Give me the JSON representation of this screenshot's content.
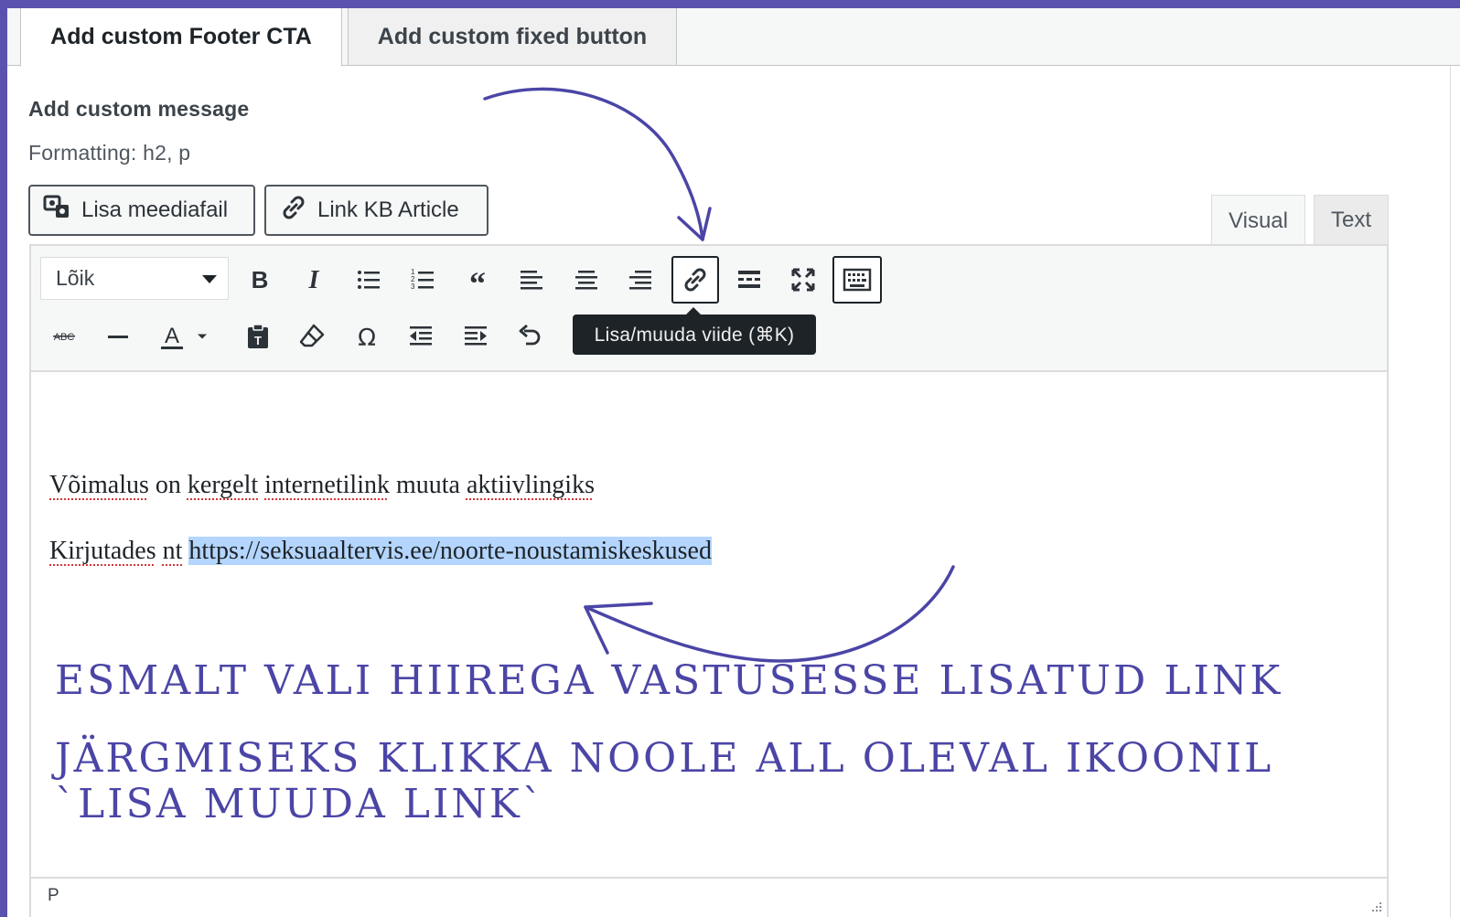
{
  "tabs": [
    {
      "label": "Add custom Footer CTA",
      "active": true
    },
    {
      "label": "Add custom fixed button",
      "active": false
    }
  ],
  "field": {
    "label": "Add custom message",
    "formatting": "Formatting: h2, p"
  },
  "buttons": {
    "media": "Lisa meediafail",
    "kb": "Link KB Article"
  },
  "modes": {
    "visual": "Visual",
    "text": "Text",
    "active": "visual"
  },
  "toolbar": {
    "format_select": "Lõik",
    "row1": [
      "bold-icon",
      "italic-icon",
      "bullet-list-icon",
      "numbered-list-icon",
      "blockquote-icon",
      "align-left-icon",
      "align-center-icon",
      "align-right-icon",
      "link-icon",
      "read-more-icon",
      "fullscreen-icon",
      "toolbar-toggle-icon"
    ],
    "row2": [
      "strikethrough-icon",
      "horizontal-line-icon",
      "text-color-icon",
      "paste-text-icon",
      "clear-formatting-icon",
      "special-character-icon",
      "outdent-icon",
      "indent-icon",
      "undo-icon"
    ],
    "tooltip": "Lisa/muuda viide (⌘K)"
  },
  "content": {
    "line1": {
      "w1": "Võimalus",
      "w2": "on",
      "w3": "kergelt",
      "w4": "internetilink",
      "w5": "muuta",
      "w6": "aktiivlingiks"
    },
    "line2": {
      "w1": "Kirjutades",
      "w2": "nt",
      "url": "https://seksuaaltervis.ee/noorte-noustamiskeskused"
    }
  },
  "status": {
    "path": "P"
  },
  "annotations": {
    "step1": "Esmalt vali hiirega vastusesse lisatud link",
    "step2": "Järgmiseks klikka noole all oleval ikoonil `Lisa muuda link`"
  },
  "colors": {
    "frame": "#5b52b0",
    "annotation": "#4b45a6",
    "selection": "#b4d5fe",
    "tooltip_bg": "#1d2327"
  }
}
